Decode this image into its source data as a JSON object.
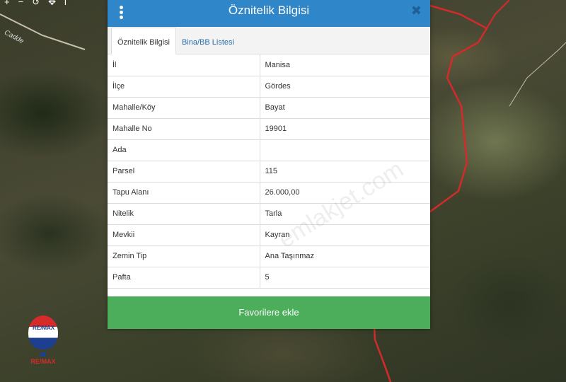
{
  "map": {
    "road_label": "Cadde",
    "toolbar_icons": [
      "plus-icon",
      "minus-icon",
      "rotate-icon",
      "move-icon",
      "info-icon"
    ]
  },
  "logo": {
    "text": "RE/MAX",
    "sub_text": "RE/MAX"
  },
  "dialog": {
    "title": "Öznitelik Bilgisi",
    "close_label": "✖",
    "tabs": [
      {
        "label": "Öznitelik Bilgisi",
        "active": true
      },
      {
        "label": "Bina/BB Listesi",
        "active": false
      }
    ],
    "rows": [
      {
        "key": "İl",
        "value": "Manisa"
      },
      {
        "key": "İlçe",
        "value": "Gördes"
      },
      {
        "key": "Mahalle/Köy",
        "value": "Bayat"
      },
      {
        "key": "Mahalle No",
        "value": "19901"
      },
      {
        "key": "Ada",
        "value": ""
      },
      {
        "key": "Parsel",
        "value": "115"
      },
      {
        "key": "Tapu Alanı",
        "value": "26.000,00"
      },
      {
        "key": "Nitelik",
        "value": "Tarla"
      },
      {
        "key": "Mevkii",
        "value": "Kayran"
      },
      {
        "key": "Zemin Tip",
        "value": "Ana Taşınmaz"
      },
      {
        "key": "Pafta",
        "value": "5"
      }
    ],
    "favorite_button": "Favorilere ekle"
  },
  "watermark": "emlakjet.com",
  "colors": {
    "header": "#2f87c9",
    "button": "#4cae5a",
    "parcel_border": "#d42a2a"
  }
}
